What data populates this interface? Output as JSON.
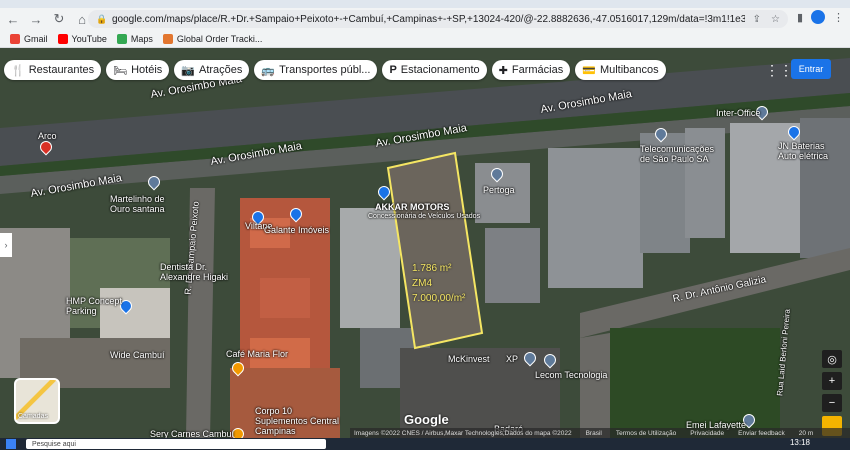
{
  "browser": {
    "url": "google.com/maps/place/R.+Dr.+Sampaio+Peixoto+-+Cambuí,+Campinas+-+SP,+13024-420/@-22.8882636,-47.0516017,129m/data=!3m1!1e3!4m5!3m4!1s...",
    "bookmarks": [
      {
        "label": "Gmail",
        "color": "#ea4335"
      },
      {
        "label": "YouTube",
        "color": "#ff0000"
      },
      {
        "label": "Maps",
        "color": "#34a853"
      },
      {
        "label": "Global Order Tracki...",
        "color": "#e2762f"
      }
    ]
  },
  "chips": [
    {
      "icon": "🍴",
      "label": "Restaurantes"
    },
    {
      "icon": "🛏",
      "label": "Hotéis"
    },
    {
      "icon": "📷",
      "label": "Atrações"
    },
    {
      "icon": "🚌",
      "label": "Transportes públ..."
    },
    {
      "icon": "P",
      "label": "Estacionamento"
    },
    {
      "icon": "✚",
      "label": "Farmácias"
    },
    {
      "icon": "💳",
      "label": "Multibancos"
    }
  ],
  "login_label": "Entrar",
  "roads": {
    "orosimbo_1": "Av. Orosimbo Maia",
    "orosimbo_2": "Av. Orosimbo Maia",
    "orosimbo_3": "Av. Orosimbo Maia",
    "orosimbo_4": "Av. Orosimbo Maia",
    "orosimbo_5": "Av. Orosimbo Maia",
    "sampaio": "R. Dr. Sampaio Peixoto",
    "galizia": "R. Dr. Antônio Galizia",
    "laid": "Rua Laid Berloni Pereira"
  },
  "places": {
    "arco": "Arco",
    "martelinho": "Martelinho de Ouro santana",
    "viltane": "Viltane",
    "galante": "Galante Imóveis",
    "akkar": "AKKAR MOTORS",
    "akkar_sub": "Concessionária de Veículos Usados",
    "pertoga": "Pertoga",
    "telecom": "Telecomunicações de São Paulo SA",
    "interoffice": "Inter-Office",
    "jn": "JN Baterias Auto elétrica",
    "dentista": "Dentista Dr. Alexandre Higaki",
    "hmp": "HMP Concept Parking",
    "wide": "Wide Cambuí",
    "cafe": "Café Maria Flor",
    "corpo": "Corpo 10 Suplementos Central Campinas",
    "sery": "Sery Carnes Cambuí",
    "mckinvest": "McKinvest",
    "xp": "XP",
    "lecom": "Lecom Tecnologia",
    "emei": "Emei Lafayette",
    "badaro": "Badaró"
  },
  "lot": {
    "line1": "1.786 m²",
    "line2": "ZM4",
    "line3": "7.000,00/m²"
  },
  "layers_label": "Camadas",
  "attribution": [
    "Imagens ©2022 CNES / Airbus,Maxar Technologies,Dados do mapa ©2022",
    "Brasil",
    "Termos de Utilização",
    "Privacidade",
    "Enviar feedback",
    "20 m"
  ],
  "google_logo": "Google",
  "taskbar": {
    "search_placeholder": "Pesquise aqui",
    "time": "13:18"
  }
}
